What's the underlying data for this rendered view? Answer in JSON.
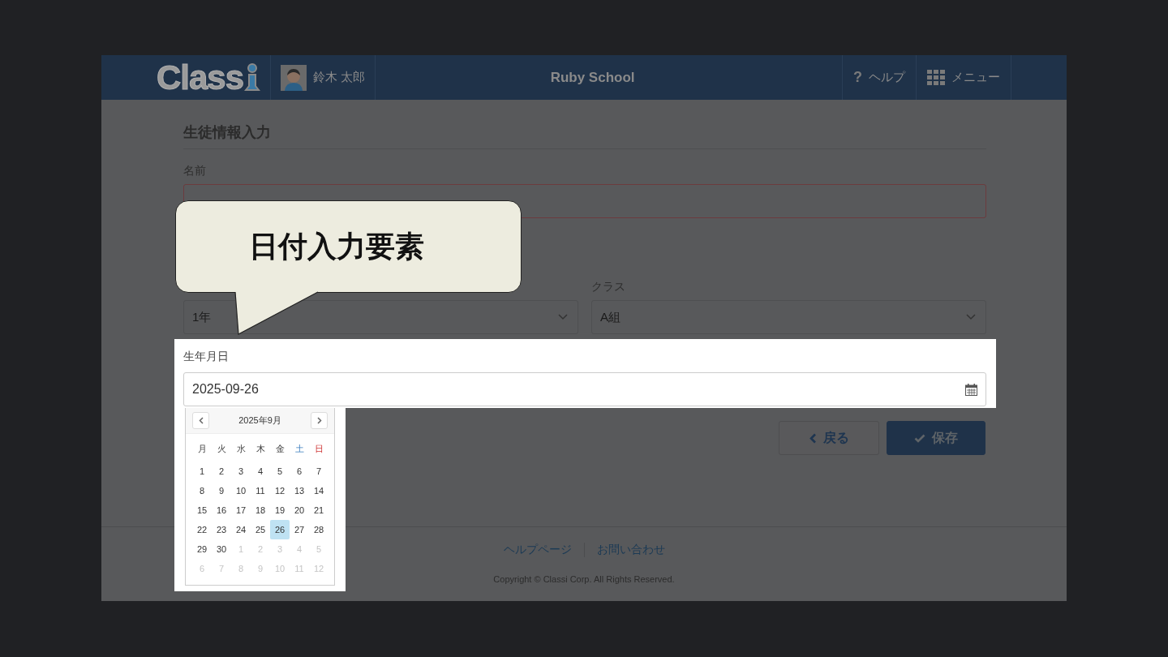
{
  "header": {
    "logo": "Class",
    "user": {
      "name": "鈴木 太郎"
    },
    "school": "Ruby School",
    "nav": [
      {
        "kind": "help",
        "icon": "?",
        "label": "ヘルプ"
      },
      {
        "kind": "menu",
        "label": "メニュー"
      }
    ]
  },
  "form": {
    "title": "生徒情報入力",
    "name_field": {
      "label": "名前",
      "error": true
    },
    "grade_field": {
      "value": "1年"
    },
    "class_field": {
      "label": "クラス",
      "value": "A組"
    },
    "birthday_field": {
      "label": "生年月日",
      "value": "2025-09-26"
    },
    "calendar": {
      "title": "2025年9月",
      "weekdays": [
        {
          "label": "月",
          "kind": "weekday"
        },
        {
          "label": "火",
          "kind": "weekday"
        },
        {
          "label": "水",
          "kind": "weekday"
        },
        {
          "label": "木",
          "kind": "weekday"
        },
        {
          "label": "金",
          "kind": "weekday"
        },
        {
          "label": "土",
          "kind": "saturday"
        },
        {
          "label": "日",
          "kind": "sunday"
        }
      ],
      "weeks": [
        [
          {
            "label": "1",
            "other_month": false,
            "selected": false
          },
          {
            "label": "2",
            "other_month": false,
            "selected": false
          },
          {
            "label": "3",
            "other_month": false,
            "selected": false
          },
          {
            "label": "4",
            "other_month": false,
            "selected": false
          },
          {
            "label": "5",
            "other_month": false,
            "selected": false
          },
          {
            "label": "6",
            "other_month": false,
            "selected": false
          },
          {
            "label": "7",
            "other_month": false,
            "selected": false
          }
        ],
        [
          {
            "label": "8",
            "other_month": false,
            "selected": false
          },
          {
            "label": "9",
            "other_month": false,
            "selected": false
          },
          {
            "label": "10",
            "other_month": false,
            "selected": false
          },
          {
            "label": "11",
            "other_month": false,
            "selected": false
          },
          {
            "label": "12",
            "other_month": false,
            "selected": false
          },
          {
            "label": "13",
            "other_month": false,
            "selected": false
          },
          {
            "label": "14",
            "other_month": false,
            "selected": false
          }
        ],
        [
          {
            "label": "15",
            "other_month": false,
            "selected": false
          },
          {
            "label": "16",
            "other_month": false,
            "selected": false
          },
          {
            "label": "17",
            "other_month": false,
            "selected": false
          },
          {
            "label": "18",
            "other_month": false,
            "selected": false
          },
          {
            "label": "19",
            "other_month": false,
            "selected": false
          },
          {
            "label": "20",
            "other_month": false,
            "selected": false
          },
          {
            "label": "21",
            "other_month": false,
            "selected": false
          }
        ],
        [
          {
            "label": "22",
            "other_month": false,
            "selected": false
          },
          {
            "label": "23",
            "other_month": false,
            "selected": false
          },
          {
            "label": "24",
            "other_month": false,
            "selected": false
          },
          {
            "label": "25",
            "other_month": false,
            "selected": false
          },
          {
            "label": "26",
            "other_month": false,
            "selected": true
          },
          {
            "label": "27",
            "other_month": false,
            "selected": false
          },
          {
            "label": "28",
            "other_month": false,
            "selected": false
          }
        ],
        [
          {
            "label": "29",
            "other_month": false,
            "selected": false
          },
          {
            "label": "30",
            "other_month": false,
            "selected": false
          },
          {
            "label": "1",
            "other_month": true,
            "selected": false
          },
          {
            "label": "2",
            "other_month": true,
            "selected": false
          },
          {
            "label": "3",
            "other_month": true,
            "selected": false
          },
          {
            "label": "4",
            "other_month": true,
            "selected": false
          },
          {
            "label": "5",
            "other_month": true,
            "selected": false
          }
        ],
        [
          {
            "label": "6",
            "other_month": true,
            "selected": false
          },
          {
            "label": "7",
            "other_month": true,
            "selected": false
          },
          {
            "label": "8",
            "other_month": true,
            "selected": false
          },
          {
            "label": "9",
            "other_month": true,
            "selected": false
          },
          {
            "label": "10",
            "other_month": true,
            "selected": false
          },
          {
            "label": "11",
            "other_month": true,
            "selected": false
          },
          {
            "label": "12",
            "other_month": true,
            "selected": false
          }
        ]
      ]
    },
    "buttons": [
      {
        "kind": "back",
        "label": "戻る"
      },
      {
        "kind": "save",
        "label": "保存"
      }
    ]
  },
  "footer": {
    "links": [
      "ヘルプページ",
      "お問い合わせ"
    ],
    "copyright": "Copyright © Classi Corp. All Rights Reserved."
  },
  "callout": {
    "text": "日付入力要素"
  }
}
